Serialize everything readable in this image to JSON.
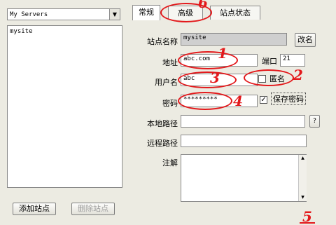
{
  "servers": {
    "selected": "My Servers",
    "items": [
      "mysite"
    ],
    "add_button": "添加站点",
    "delete_button": "删除站点"
  },
  "tabs": [
    "常规",
    "高级",
    "站点状态"
  ],
  "form": {
    "site_name_label": "站点名称",
    "site_name_value": "mysite",
    "rename_button": "改名",
    "address_label": "地址",
    "address_value": "abc.com",
    "port_label": "端口",
    "port_value": "21",
    "username_label": "用户名",
    "username_value": "abc",
    "anonymous_label": "匿名",
    "password_label": "密码",
    "password_value": "*********",
    "save_password_label": "保存密码",
    "save_password_checked": true,
    "local_path_label": "本地路径",
    "local_path_value": "",
    "remote_path_label": "远程路径",
    "remote_path_value": "",
    "notes_label": "注解",
    "notes_value": ""
  },
  "annotations": [
    "1",
    "2",
    "3",
    "4",
    "5",
    "6"
  ],
  "colors": {
    "annotation": "#e3181b",
    "background": "#ecebe2"
  }
}
